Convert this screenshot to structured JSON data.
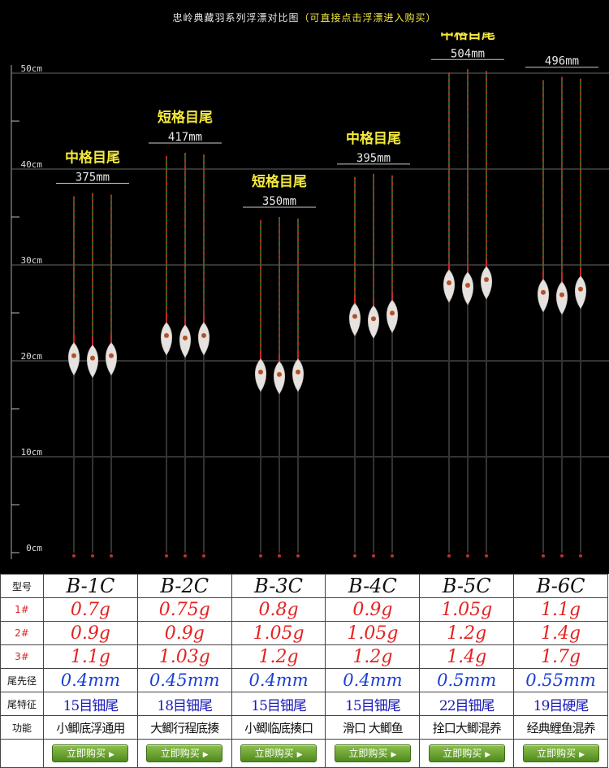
{
  "header": {
    "title": "忠岭典藏羽系列浮漂对比图",
    "note": "（可直接点击浮漂进入购买）"
  },
  "chart_data": {
    "type": "comparison",
    "ylabel": "cm",
    "yticks": [
      "0cm",
      "10cm",
      "20cm",
      "30cm",
      "40cm",
      "50cm"
    ],
    "ylim": [
      0,
      50
    ],
    "groups": [
      {
        "model": "B-1C",
        "tail": "中格目尾",
        "length": "375mm",
        "length_mm": 375
      },
      {
        "model": "B-2C",
        "tail": "短格目尾",
        "length": "417mm",
        "length_mm": 417
      },
      {
        "model": "B-3C",
        "tail": "短格目尾",
        "length": "350mm",
        "length_mm": 350
      },
      {
        "model": "B-4C",
        "tail": "中格目尾",
        "length": "395mm",
        "length_mm": 395
      },
      {
        "model": "B-5C",
        "tail": "中格目尾",
        "length": "504mm",
        "length_mm": 504
      },
      {
        "model": "B-6C",
        "tail": "",
        "length": "496mm",
        "length_mm": 496
      }
    ]
  },
  "table": {
    "row_labels": {
      "model": "型号",
      "w1": "1#",
      "w2": "2#",
      "w3": "3#",
      "tip": "尾先径",
      "feature": "尾特征",
      "function": "功能"
    },
    "columns": [
      {
        "model": "B-1C",
        "w1": "0.7g",
        "w2": "0.9g",
        "w3": "1.1g",
        "tip": "0.4mm",
        "feature": "15目钿尾",
        "function": "小鲫底浮通用"
      },
      {
        "model": "B-2C",
        "w1": "0.75g",
        "w2": "0.9g",
        "w3": "1.03g",
        "tip": "0.45mm",
        "feature": "18目钿尾",
        "function": "大鲫行程底揍"
      },
      {
        "model": "B-3C",
        "w1": "0.8g",
        "w2": "1.05g",
        "w3": "1.2g",
        "tip": "0.4mm",
        "feature": "15目钿尾",
        "function": "小鲫临底揍口"
      },
      {
        "model": "B-4C",
        "w1": "0.9g",
        "w2": "1.05g",
        "w3": "1.2g",
        "tip": "0.4mm",
        "feature": "15目钿尾",
        "function": "滑口 大鲫鱼"
      },
      {
        "model": "B-5C",
        "w1": "1.05g",
        "w2": "1.2g",
        "w3": "1.4g",
        "tip": "0.5mm",
        "feature": "22目钿尾",
        "function": "拴口大鲫混养"
      },
      {
        "model": "B-6C",
        "w1": "1.1g",
        "w2": "1.4g",
        "w3": "1.7g",
        "tip": "0.55mm",
        "feature": "19目硬尾",
        "function": "经典鲤鱼混养"
      }
    ],
    "buy_label": "立即购买"
  },
  "colors": {
    "label_yellow": "#f5ea3a",
    "weight_red": "#e52222",
    "dia_blue": "#1a3fd6",
    "buy_green": "#5a9a24"
  }
}
